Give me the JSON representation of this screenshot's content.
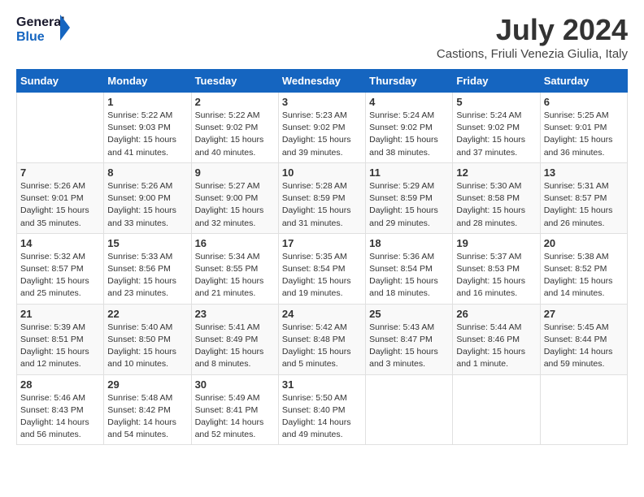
{
  "header": {
    "logo_line1": "General",
    "logo_line2": "Blue",
    "title": "July 2024",
    "subtitle": "Castions, Friuli Venezia Giulia, Italy"
  },
  "weekdays": [
    "Sunday",
    "Monday",
    "Tuesday",
    "Wednesday",
    "Thursday",
    "Friday",
    "Saturday"
  ],
  "weeks": [
    [
      {
        "num": "",
        "lines": []
      },
      {
        "num": "1",
        "lines": [
          "Sunrise: 5:22 AM",
          "Sunset: 9:03 PM",
          "Daylight: 15 hours",
          "and 41 minutes."
        ]
      },
      {
        "num": "2",
        "lines": [
          "Sunrise: 5:22 AM",
          "Sunset: 9:02 PM",
          "Daylight: 15 hours",
          "and 40 minutes."
        ]
      },
      {
        "num": "3",
        "lines": [
          "Sunrise: 5:23 AM",
          "Sunset: 9:02 PM",
          "Daylight: 15 hours",
          "and 39 minutes."
        ]
      },
      {
        "num": "4",
        "lines": [
          "Sunrise: 5:24 AM",
          "Sunset: 9:02 PM",
          "Daylight: 15 hours",
          "and 38 minutes."
        ]
      },
      {
        "num": "5",
        "lines": [
          "Sunrise: 5:24 AM",
          "Sunset: 9:02 PM",
          "Daylight: 15 hours",
          "and 37 minutes."
        ]
      },
      {
        "num": "6",
        "lines": [
          "Sunrise: 5:25 AM",
          "Sunset: 9:01 PM",
          "Daylight: 15 hours",
          "and 36 minutes."
        ]
      }
    ],
    [
      {
        "num": "7",
        "lines": [
          "Sunrise: 5:26 AM",
          "Sunset: 9:01 PM",
          "Daylight: 15 hours",
          "and 35 minutes."
        ]
      },
      {
        "num": "8",
        "lines": [
          "Sunrise: 5:26 AM",
          "Sunset: 9:00 PM",
          "Daylight: 15 hours",
          "and 33 minutes."
        ]
      },
      {
        "num": "9",
        "lines": [
          "Sunrise: 5:27 AM",
          "Sunset: 9:00 PM",
          "Daylight: 15 hours",
          "and 32 minutes."
        ]
      },
      {
        "num": "10",
        "lines": [
          "Sunrise: 5:28 AM",
          "Sunset: 8:59 PM",
          "Daylight: 15 hours",
          "and 31 minutes."
        ]
      },
      {
        "num": "11",
        "lines": [
          "Sunrise: 5:29 AM",
          "Sunset: 8:59 PM",
          "Daylight: 15 hours",
          "and 29 minutes."
        ]
      },
      {
        "num": "12",
        "lines": [
          "Sunrise: 5:30 AM",
          "Sunset: 8:58 PM",
          "Daylight: 15 hours",
          "and 28 minutes."
        ]
      },
      {
        "num": "13",
        "lines": [
          "Sunrise: 5:31 AM",
          "Sunset: 8:57 PM",
          "Daylight: 15 hours",
          "and 26 minutes."
        ]
      }
    ],
    [
      {
        "num": "14",
        "lines": [
          "Sunrise: 5:32 AM",
          "Sunset: 8:57 PM",
          "Daylight: 15 hours",
          "and 25 minutes."
        ]
      },
      {
        "num": "15",
        "lines": [
          "Sunrise: 5:33 AM",
          "Sunset: 8:56 PM",
          "Daylight: 15 hours",
          "and 23 minutes."
        ]
      },
      {
        "num": "16",
        "lines": [
          "Sunrise: 5:34 AM",
          "Sunset: 8:55 PM",
          "Daylight: 15 hours",
          "and 21 minutes."
        ]
      },
      {
        "num": "17",
        "lines": [
          "Sunrise: 5:35 AM",
          "Sunset: 8:54 PM",
          "Daylight: 15 hours",
          "and 19 minutes."
        ]
      },
      {
        "num": "18",
        "lines": [
          "Sunrise: 5:36 AM",
          "Sunset: 8:54 PM",
          "Daylight: 15 hours",
          "and 18 minutes."
        ]
      },
      {
        "num": "19",
        "lines": [
          "Sunrise: 5:37 AM",
          "Sunset: 8:53 PM",
          "Daylight: 15 hours",
          "and 16 minutes."
        ]
      },
      {
        "num": "20",
        "lines": [
          "Sunrise: 5:38 AM",
          "Sunset: 8:52 PM",
          "Daylight: 15 hours",
          "and 14 minutes."
        ]
      }
    ],
    [
      {
        "num": "21",
        "lines": [
          "Sunrise: 5:39 AM",
          "Sunset: 8:51 PM",
          "Daylight: 15 hours",
          "and 12 minutes."
        ]
      },
      {
        "num": "22",
        "lines": [
          "Sunrise: 5:40 AM",
          "Sunset: 8:50 PM",
          "Daylight: 15 hours",
          "and 10 minutes."
        ]
      },
      {
        "num": "23",
        "lines": [
          "Sunrise: 5:41 AM",
          "Sunset: 8:49 PM",
          "Daylight: 15 hours",
          "and 8 minutes."
        ]
      },
      {
        "num": "24",
        "lines": [
          "Sunrise: 5:42 AM",
          "Sunset: 8:48 PM",
          "Daylight: 15 hours",
          "and 5 minutes."
        ]
      },
      {
        "num": "25",
        "lines": [
          "Sunrise: 5:43 AM",
          "Sunset: 8:47 PM",
          "Daylight: 15 hours",
          "and 3 minutes."
        ]
      },
      {
        "num": "26",
        "lines": [
          "Sunrise: 5:44 AM",
          "Sunset: 8:46 PM",
          "Daylight: 15 hours",
          "and 1 minute."
        ]
      },
      {
        "num": "27",
        "lines": [
          "Sunrise: 5:45 AM",
          "Sunset: 8:44 PM",
          "Daylight: 14 hours",
          "and 59 minutes."
        ]
      }
    ],
    [
      {
        "num": "28",
        "lines": [
          "Sunrise: 5:46 AM",
          "Sunset: 8:43 PM",
          "Daylight: 14 hours",
          "and 56 minutes."
        ]
      },
      {
        "num": "29",
        "lines": [
          "Sunrise: 5:48 AM",
          "Sunset: 8:42 PM",
          "Daylight: 14 hours",
          "and 54 minutes."
        ]
      },
      {
        "num": "30",
        "lines": [
          "Sunrise: 5:49 AM",
          "Sunset: 8:41 PM",
          "Daylight: 14 hours",
          "and 52 minutes."
        ]
      },
      {
        "num": "31",
        "lines": [
          "Sunrise: 5:50 AM",
          "Sunset: 8:40 PM",
          "Daylight: 14 hours",
          "and 49 minutes."
        ]
      },
      {
        "num": "",
        "lines": []
      },
      {
        "num": "",
        "lines": []
      },
      {
        "num": "",
        "lines": []
      }
    ]
  ]
}
